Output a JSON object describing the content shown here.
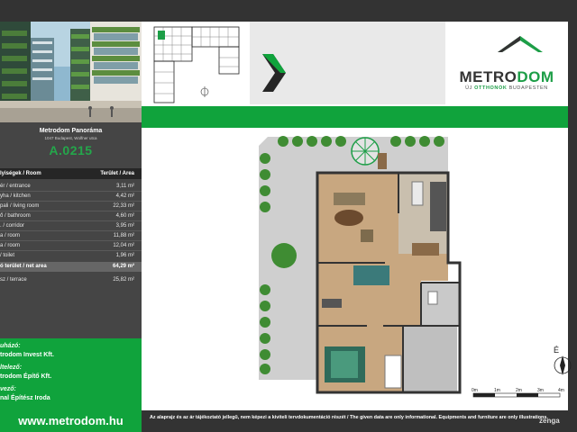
{
  "project": {
    "name": "Metrodom Panoráma",
    "address": "1047 Budapest, Wolfner utca",
    "unit": "A.0215"
  },
  "table": {
    "head_room": "lyiségek / Room",
    "head_area": "Terület / Area",
    "rows": [
      {
        "room": "ér / entrance",
        "area": "3,11 m²"
      },
      {
        "room": "yha / kitchen",
        "area": "4,42 m²"
      },
      {
        "room": "pali / living room",
        "area": "22,33 m²"
      },
      {
        "room": "ő / bathroom",
        "area": "4,60 m²"
      },
      {
        "room": ". / corridor",
        "area": "3,95 m²"
      },
      {
        "room": "a / room",
        "area": "11,88 m²"
      },
      {
        "room": "a / room",
        "area": "12,04 m²"
      },
      {
        "room": "/ toilet",
        "area": "1,96 m²"
      }
    ],
    "net_label": "ó terület / net area",
    "net_value": "64,29 m²",
    "terrace_label": "sz / terrace",
    "terrace_value": "25,82 m²"
  },
  "info": {
    "l1": "uházó:",
    "v1": "trodom Invest Kft.",
    "l2": "ltelező:",
    "v2": "trodom Építő Kft.",
    "l3": "vező:",
    "v3": "nal Építész Iroda"
  },
  "brand": {
    "metro": "METRO",
    "dom": "DOM",
    "sub_pre": "ÚJ ",
    "sub_green": "OTTHONOK",
    "sub_post": " BUDAPESTEN",
    "green": "#10a33c",
    "dark": "#333333"
  },
  "website": "www.metrodom.hu",
  "disclaimer": "Az alaprajz és az ár tájékoztató jellegű, nem képezi a kiviteli tervdokumentáció részét / The given data are only informational. Equipments and furniture are only illustrations.",
  "compass_label": "É",
  "scale": {
    "ticks": [
      "0m",
      "1m",
      "2m",
      "3m",
      "4m"
    ]
  },
  "watermark": "zenga"
}
